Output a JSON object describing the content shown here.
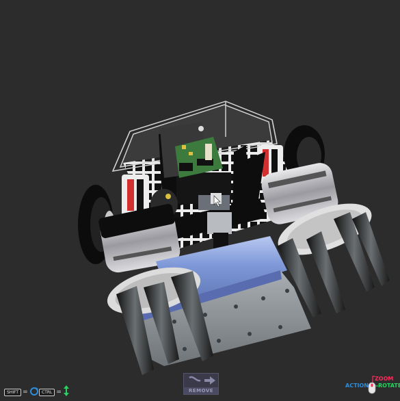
{
  "viewport": {
    "background": "#2c2c2c",
    "model_name": "robot-3d-model"
  },
  "hints": {
    "shift_key": "SHIFT",
    "shift_eq": "=",
    "shift_icon": "rotate-circle-icon",
    "ctrl_key": "CTRL",
    "ctrl_eq": "=",
    "ctrl_icon": "vertical-arrows-icon"
  },
  "remove_button": {
    "label": "REMOVE",
    "icon": "detach-arrow-icon"
  },
  "mouse_legend": {
    "zoom": "ZOOM",
    "action": "ACTION",
    "rotate": "ROTATE",
    "colors": {
      "zoom": "#ff2a5a",
      "action": "#2a8fe0",
      "rotate": "#2ad060"
    }
  }
}
